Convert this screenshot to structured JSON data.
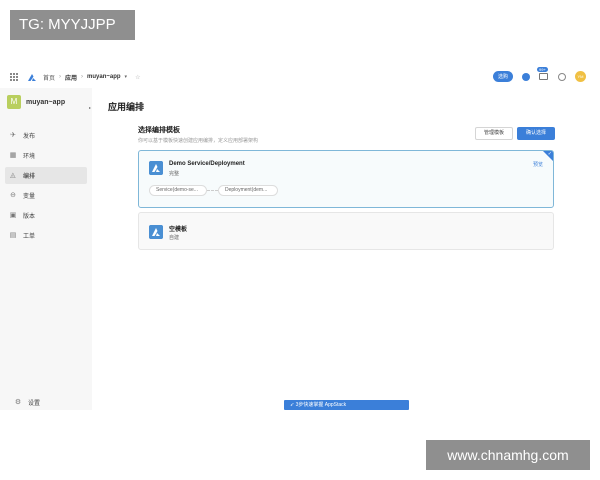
{
  "watermarks": {
    "top_left": "TG: MYYJJPP",
    "bottom_right": "www.chnamhg.com"
  },
  "topbar": {
    "breadcrumb_home": "首页",
    "breadcrumb_apps": "应用",
    "breadcrumb_app": "muyan~app",
    "pill_label": "选购",
    "badge_count": "99+",
    "avatar_text": "YM"
  },
  "sidebar": {
    "app_initial": "M",
    "app_name": "muyan~app",
    "items": [
      {
        "label": "发布",
        "icon": "send-icon"
      },
      {
        "label": "环境",
        "icon": "grid-icon"
      },
      {
        "label": "编排",
        "icon": "layers-icon"
      },
      {
        "label": "变量",
        "icon": "variable-icon"
      },
      {
        "label": "版本",
        "icon": "version-icon"
      },
      {
        "label": "工单",
        "icon": "ticket-icon"
      }
    ],
    "settings_label": "设置"
  },
  "main": {
    "page_title": "应用编排",
    "section_title": "选择编排模板",
    "section_desc": "你可以基于模板快速创建应用编排，定义应用部署架构",
    "manage_button": "管理模板",
    "confirm_button": "确认选择",
    "templates": [
      {
        "name": "Demo Service/Deployment",
        "sub": "完整",
        "preview": "预览",
        "resources": [
          "Service(demo-se...",
          "Deployment(dem..."
        ]
      },
      {
        "name": "空模板",
        "sub": "自建"
      }
    ]
  },
  "banner": {
    "text": "3步快速掌握 AppStack"
  },
  "colors": {
    "accent": "#3b7fd9",
    "selected_border": "#7fb7d8",
    "sidebar_bg": "#f7f7f7",
    "app_avatar": "#b9cf5e"
  }
}
